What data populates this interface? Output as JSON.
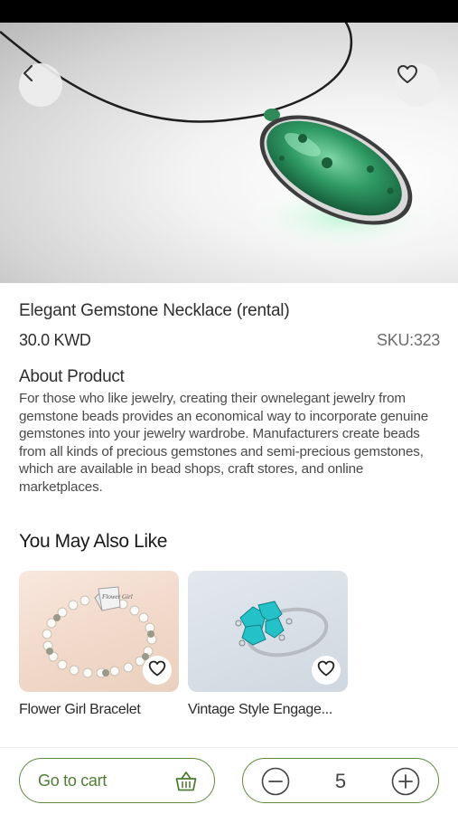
{
  "product": {
    "title": "Elegant Gemstone Necklace (rental)",
    "price": "30.0 KWD",
    "sku": "SKU:323",
    "about_heading": "About Product",
    "about_text": "For those who like jewelry, creating their ownelegant jewelry from gemstone beads provides an economical way to incorporate genuine gemstones into your jewelry wardrobe. Manufacturers create beads from all kinds of precious gemstones and semi-precious gemstones, which are available in bead shops, craft stores, and online marketplaces."
  },
  "recommendations": {
    "heading": "You May Also Like",
    "items": [
      {
        "name": "Flower Girl Bracelet",
        "charm_text": "Flower Girl"
      },
      {
        "name": "Vintage Style Engage..."
      }
    ]
  },
  "bottom_bar": {
    "cart_label": "Go to cart",
    "quantity": "5"
  },
  "icons": {
    "back": "chevron-left-icon",
    "favorite": "heart-outline-icon",
    "cart": "basket-icon",
    "minus": "minus-circle-icon",
    "plus": "plus-circle-icon"
  },
  "colors": {
    "accent": "#4f7d33",
    "gem": "#2e8b57"
  }
}
